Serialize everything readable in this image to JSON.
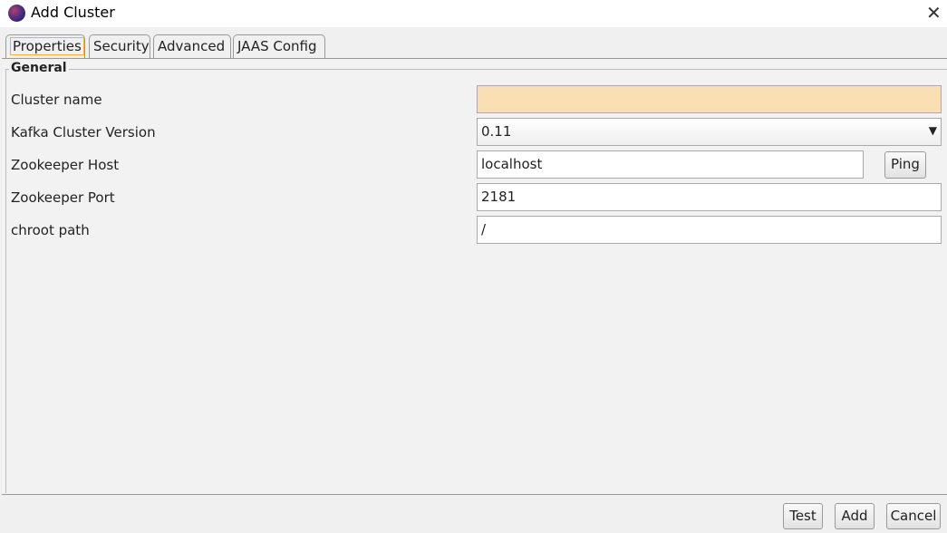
{
  "window": {
    "title": "Add Cluster"
  },
  "tabs": [
    "Properties",
    "Security",
    "Advanced",
    "JAAS Config"
  ],
  "group": {
    "title": "General"
  },
  "fields": {
    "cluster_name": {
      "label": "Cluster name",
      "value": ""
    },
    "kafka_version": {
      "label": "Kafka Cluster Version",
      "value": "0.11"
    },
    "zk_host": {
      "label": "Zookeeper Host",
      "value": "localhost"
    },
    "zk_port": {
      "label": "Zookeeper Port",
      "value": "2181"
    },
    "chroot": {
      "label": "chroot path",
      "value": "/"
    }
  },
  "buttons": {
    "ping": "Ping",
    "test": "Test",
    "add": "Add",
    "cancel": "Cancel"
  },
  "colors": {
    "required_field": "#fadfb4",
    "active_tab_focus": "#f0b040"
  }
}
